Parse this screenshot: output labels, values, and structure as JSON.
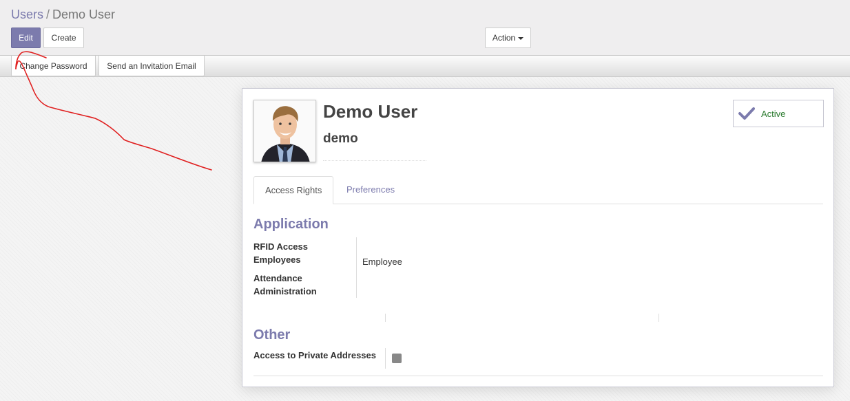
{
  "breadcrumb": {
    "parent": "Users",
    "separator": "/",
    "current": "Demo User"
  },
  "toolbar": {
    "edit_label": "Edit",
    "create_label": "Create",
    "action_label": "Action"
  },
  "statusbar": {
    "change_password_label": "Change Password",
    "send_invitation_label": "Send an Invitation Email"
  },
  "user": {
    "name": "Demo User",
    "login": "demo",
    "status": "Active"
  },
  "tabs": [
    {
      "label": "Access Rights",
      "active": true
    },
    {
      "label": "Preferences",
      "active": false
    }
  ],
  "sections": {
    "application": {
      "title": "Application",
      "fields": [
        {
          "label": "RFID Access Employees",
          "label_line1": "RFID Access",
          "label_line2": "Employees",
          "value": "Employee"
        },
        {
          "label": "Attendance Administration",
          "label_line1": "Attendance",
          "label_line2": "Administration",
          "value": ""
        }
      ]
    },
    "other": {
      "title": "Other",
      "fields": [
        {
          "label": "Access to Private Addresses",
          "checked": false
        }
      ]
    }
  },
  "icons": {
    "active_check": "checkmark-icon",
    "action_dropdown": "caret-down-icon",
    "avatar": "user-avatar-photo"
  },
  "colors": {
    "primary": "#7c7bad",
    "annotation": "#e02020",
    "active_text": "#2e7d32"
  }
}
